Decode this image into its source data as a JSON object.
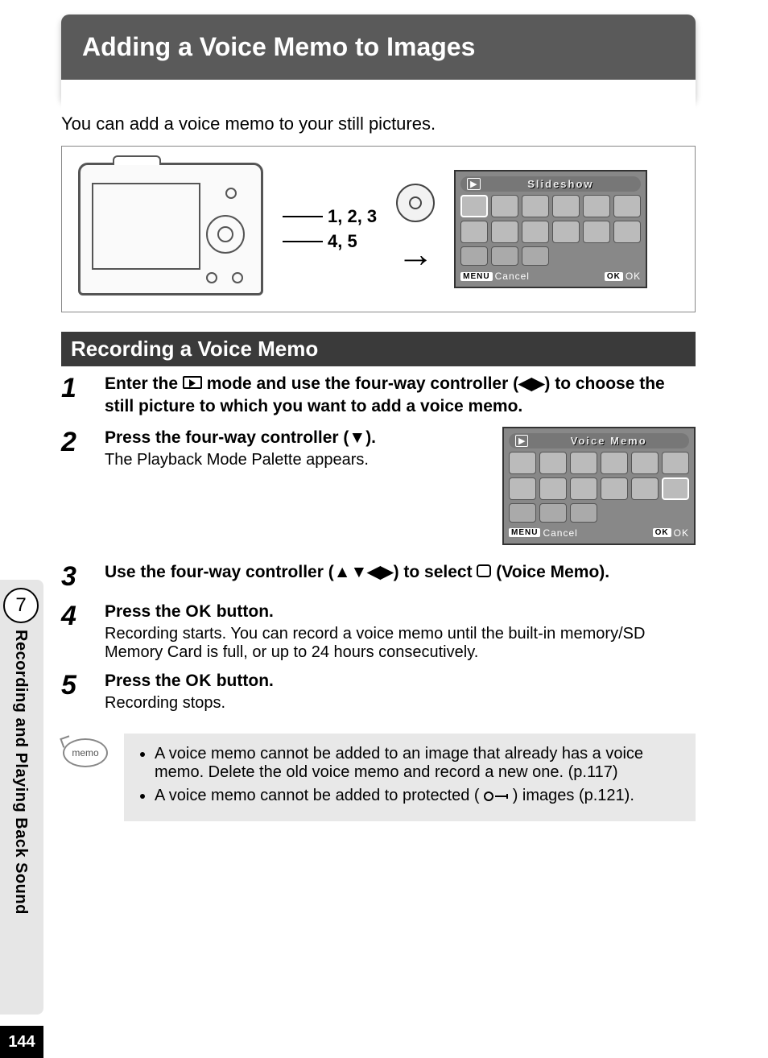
{
  "chapter": {
    "number": "7",
    "title": "Recording and Playing Back Sound"
  },
  "page_number": "144",
  "title": "Adding a Voice Memo to Images",
  "intro": "You can add a voice memo to your still pictures.",
  "figure": {
    "callout1": "1, 2, 3",
    "callout2": "4, 5",
    "lcd1": {
      "title": "Slideshow",
      "menu": "MENU",
      "cancel": "Cancel",
      "ok_btn": "OK",
      "ok": "OK"
    }
  },
  "section_heading": "Recording a Voice Memo",
  "steps": {
    "1": {
      "num": "1",
      "head_a": "Enter the ",
      "head_b": " mode and use the four-way controller (◀▶) to choose the still picture to which you want to add a voice memo."
    },
    "2": {
      "num": "2",
      "head": "Press the four-way controller (▼).",
      "sub": "The Playback Mode Palette appears."
    },
    "3": {
      "num": "3",
      "head_a": "Use the four-way controller (▲▼◀▶) to select ",
      "head_b": " (Voice Memo).",
      "lcd": {
        "title": "Voice Memo",
        "menu": "MENU",
        "cancel": "Cancel",
        "ok_btn": "OK",
        "ok": "OK"
      }
    },
    "4": {
      "num": "4",
      "head_a": "Press the ",
      "ok": "OK",
      "head_b": " button.",
      "sub": "Recording starts. You can record a voice memo until the built-in memory/SD Memory Card is full, or up to 24 hours consecutively."
    },
    "5": {
      "num": "5",
      "head_a": "Press the ",
      "ok": "OK",
      "head_b": " button.",
      "sub": "Recording stops."
    }
  },
  "memo": {
    "label": "memo",
    "item1": "A voice memo cannot be added to an image that already has a voice memo. Delete the old voice memo and record a new one. (p.117)",
    "item2a": "A voice memo cannot be added to protected (",
    "item2b": ") images (p.121)."
  }
}
